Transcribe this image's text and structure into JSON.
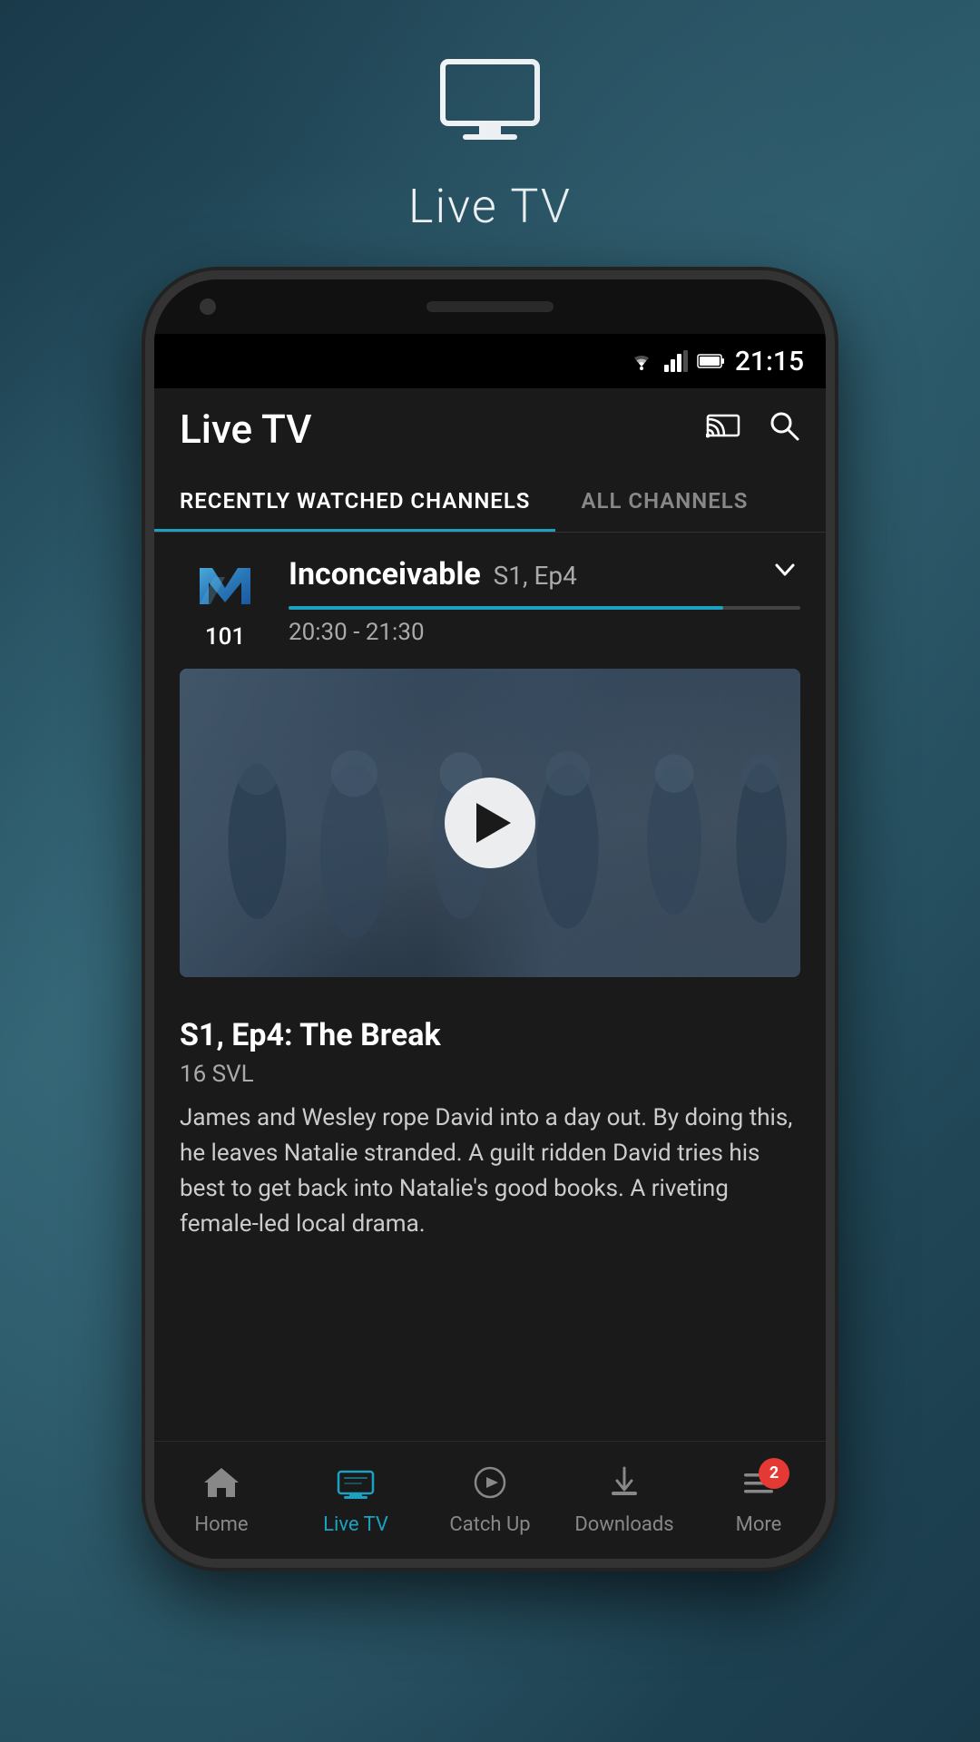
{
  "app": {
    "title": "Live TV",
    "tv_icon": "📺"
  },
  "status_bar": {
    "time": "21:15",
    "wifi": "▼",
    "signal": "▲",
    "battery": "🔋"
  },
  "app_bar": {
    "title": "Live TV",
    "cast_icon": "cast",
    "search_icon": "search"
  },
  "tabs": [
    {
      "label": "RECENTLY WATCHED CHANNELS",
      "active": true
    },
    {
      "label": "ALL CHANNELS",
      "active": false
    }
  ],
  "channel": {
    "number": "101",
    "logo_letter": "m",
    "show_title": "Inconceivable",
    "episode": "S1, Ep4",
    "time_range": "20:30 - 21:30",
    "progress_percent": 85,
    "episode_title": "S1, Ep4: The Break",
    "rating": "16 SVL",
    "description": "James and Wesley rope David into a day out. By doing this, he leaves Natalie stranded. A guilt ridden David tries his best to get back into Natalie's good books. A riveting female-led local drama."
  },
  "bottom_nav": [
    {
      "label": "Home",
      "icon": "⌂",
      "active": false,
      "id": "home"
    },
    {
      "label": "Live TV",
      "icon": "📺",
      "active": true,
      "id": "live-tv"
    },
    {
      "label": "Catch Up",
      "icon": "▷",
      "active": false,
      "id": "catch-up"
    },
    {
      "label": "Downloads",
      "icon": "⬇",
      "active": false,
      "id": "downloads"
    },
    {
      "label": "More",
      "icon": "☰",
      "active": false,
      "badge": "2",
      "id": "more"
    }
  ]
}
